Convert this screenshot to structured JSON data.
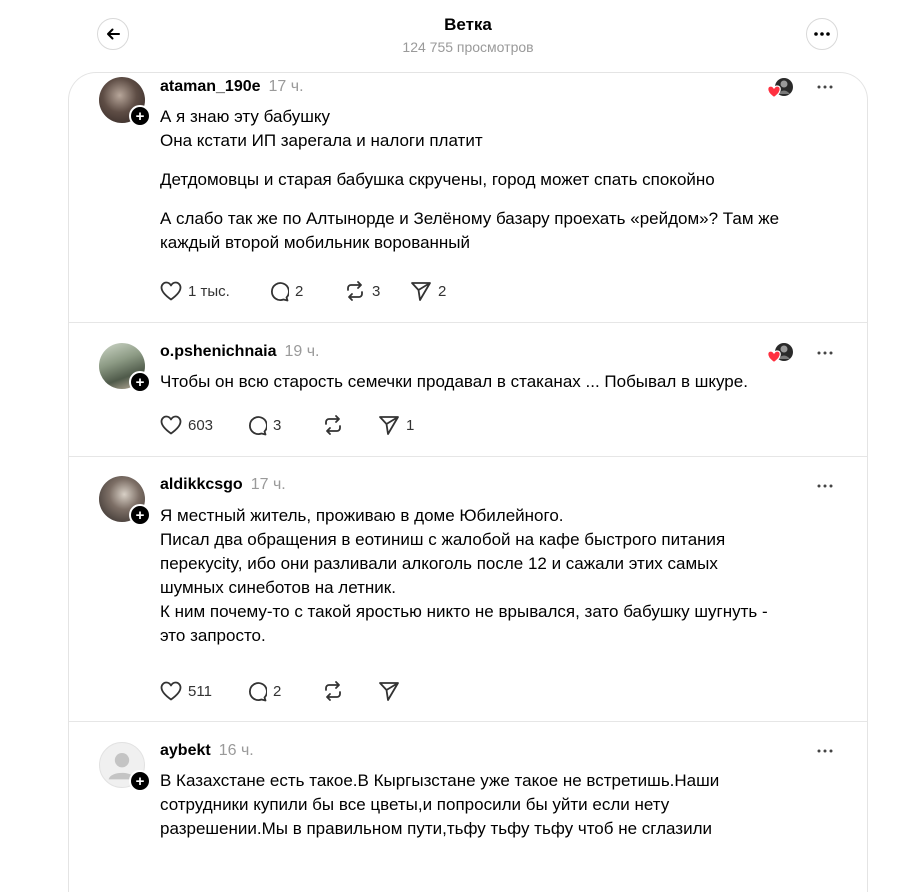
{
  "header": {
    "title": "Ветка",
    "views": "124 755 просмотров"
  },
  "posts": [
    {
      "username": "ataman_190e",
      "time": "17 ч.",
      "liked_by_author": true,
      "lines": [
        "А я знаю эту бабушку",
        "Она кстати ИП зарегала и налоги платит",
        "",
        "Детдомовцы и старая бабушка скручены, город может спать спокойно",
        "",
        "А слабо так же по Алтынорде и Зелёному базару проехать «рейдом»? Там же",
        "каждый второй мобильник ворованный"
      ],
      "likes": "1 тыс.",
      "replies": "2",
      "reposts": "3",
      "shares": "2"
    },
    {
      "username": "o.pshenichnaia",
      "time": "19 ч.",
      "liked_by_author": true,
      "lines": [
        "Чтобы он всю старость семечки продавал в стаканах ... Побывал в шкуре."
      ],
      "likes": "603",
      "replies": "3",
      "reposts": "",
      "shares": "1"
    },
    {
      "username": "aldikkcsgo",
      "time": "17 ч.",
      "liked_by_author": false,
      "lines": [
        "Я местный житель, проживаю в доме Юбилейного.",
        "Писал два обращения в еотиниш с жалобой на кафе быстрого питания",
        "перекусity, ибо они разливали алкоголь после 12 и сажали этих самых",
        "шумных синеботов на летник.",
        "К ним почему-то с такой яростью никто не врывался, зато бабушку шугнуть -",
        "это запросто."
      ],
      "likes": "511",
      "replies": "2",
      "reposts": "",
      "shares": ""
    },
    {
      "username": "aybekt",
      "time": "16 ч.",
      "liked_by_author": false,
      "lines": [
        "В Казахстане есть такое.В Кыргызстане уже такое не встретишь.Наши",
        "сотрудники купили бы все цветы,и попросили бы уйти если нету",
        "разрешении.Мы в правильном пути,тьфу тьфу тьфу чтоб не сглазили"
      ]
    }
  ],
  "colors": {
    "heart_red": "#ff3040",
    "muted": "#9a9a9a",
    "border": "#e4e4e4"
  }
}
